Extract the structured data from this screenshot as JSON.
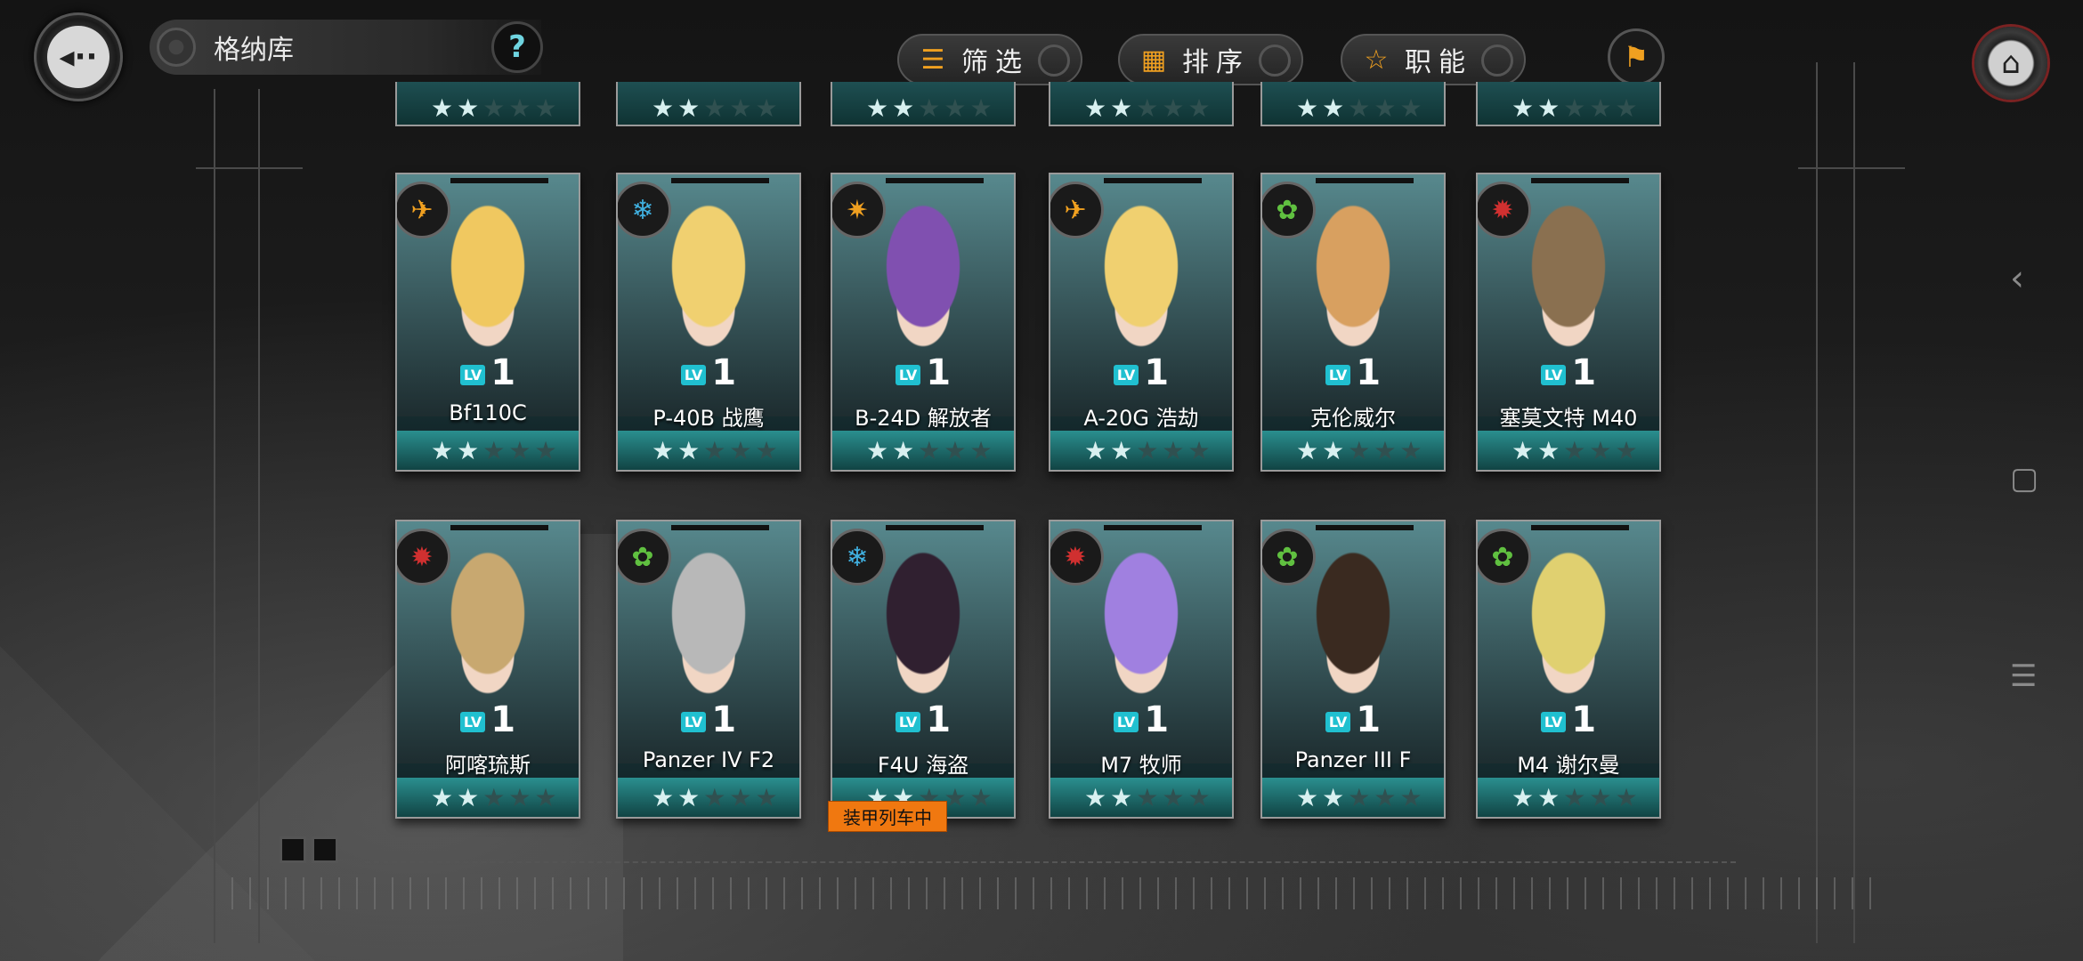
{
  "header": {
    "title": "格纳库",
    "help_label": "?",
    "filter_label": "筛选",
    "sort_label": "排序",
    "role_label": "职能"
  },
  "partial_row": [
    {
      "stars_filled": 2,
      "stars_total": 5
    },
    {
      "stars_filled": 2,
      "stars_total": 5
    },
    {
      "stars_filled": 2,
      "stars_total": 5
    },
    {
      "stars_filled": 2,
      "stars_total": 5
    },
    {
      "stars_filled": 2,
      "stars_total": 5
    },
    {
      "stars_filled": 2,
      "stars_total": 5
    }
  ],
  "cards": [
    {
      "name": "Bf110C",
      "level": "1",
      "class": "fighter",
      "stars_filled": 2,
      "stars_total": 5,
      "hair": "#f0c860",
      "class_color": "#f0a020"
    },
    {
      "name": "P-40B 战鹰",
      "level": "1",
      "class": "defense",
      "stars_filled": 2,
      "stars_total": 5,
      "hair": "#f0d070",
      "class_color": "#40b0e0"
    },
    {
      "name": "B-24D 解放者",
      "level": "1",
      "class": "bomber",
      "stars_filled": 2,
      "stars_total": 5,
      "hair": "#8050b0",
      "class_color": "#f0a020"
    },
    {
      "name": "A-20G 浩劫",
      "level": "1",
      "class": "fighter",
      "stars_filled": 2,
      "stars_total": 5,
      "hair": "#f0d070",
      "class_color": "#f0a020"
    },
    {
      "name": "克伦威尔",
      "level": "1",
      "class": "support",
      "stars_filled": 2,
      "stars_total": 5,
      "hair": "#d8a060",
      "class_color": "#60c040"
    },
    {
      "name": "塞莫文特 M40",
      "level": "1",
      "class": "assault",
      "stars_filled": 2,
      "stars_total": 5,
      "hair": "#8a7050",
      "class_color": "#d03030"
    },
    {
      "name": "阿喀琉斯",
      "level": "1",
      "class": "assault",
      "stars_filled": 2,
      "stars_total": 5,
      "hair": "#c8a870",
      "class_color": "#d03030"
    },
    {
      "name": "Panzer IV F2",
      "level": "1",
      "class": "support",
      "stars_filled": 2,
      "stars_total": 5,
      "hair": "#b8b8b8",
      "class_color": "#60c040"
    },
    {
      "name": "F4U 海盗",
      "level": "1",
      "class": "defense",
      "stars_filled": 2,
      "stars_total": 5,
      "hair": "#302030",
      "class_color": "#40b0e0"
    },
    {
      "name": "M7 牧师",
      "level": "1",
      "class": "assault",
      "stars_filled": 2,
      "stars_total": 5,
      "hair": "#a080e0",
      "class_color": "#d03030"
    },
    {
      "name": "Panzer III F",
      "level": "1",
      "class": "support",
      "stars_filled": 2,
      "stars_total": 5,
      "hair": "#3a2a20",
      "class_color": "#60c040"
    },
    {
      "name": "M4 谢尔曼",
      "level": "1",
      "class": "support",
      "stars_filled": 2,
      "stars_total": 5,
      "hair": "#e0d070",
      "class_color": "#60c040"
    }
  ],
  "train_tag": "装甲列车中",
  "icons": {
    "back": "back-arrow-icon",
    "help": "question-icon",
    "filter": "filter-lines-icon",
    "sort": "grid-icon",
    "role": "star-outline-icon",
    "flag": "flag-icon",
    "home": "home-icon"
  }
}
